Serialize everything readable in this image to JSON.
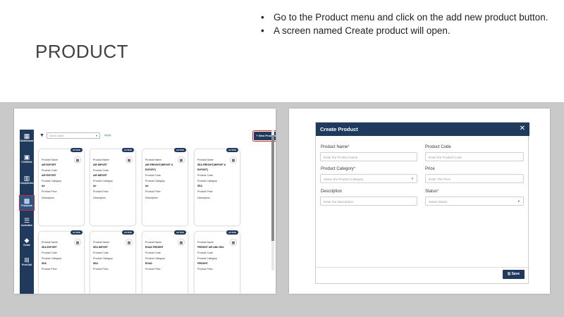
{
  "slide": {
    "title": "PRODUCT",
    "bullets": [
      "Go to the Product menu and click on the add new product button.",
      "A screen named Create product will open."
    ]
  },
  "left_screen": {
    "sidebar": [
      {
        "label": "Dashboard",
        "icon": "grid-icon",
        "glyph": "▦"
      },
      {
        "label": "Contacts",
        "icon": "contact-icon",
        "glyph": "▣"
      },
      {
        "label": "Companies",
        "icon": "building-icon",
        "glyph": "▥"
      },
      {
        "label": "Products",
        "icon": "box-icon",
        "glyph": "▩"
      },
      {
        "label": "Activities",
        "icon": "list-icon",
        "glyph": "☰"
      },
      {
        "label": "Deals",
        "icon": "tag-icon",
        "glyph": "◆"
      },
      {
        "label": "FreeCall",
        "icon": "network-icon",
        "glyph": "⊞"
      }
    ],
    "filter": {
      "placeholder": "Select Name",
      "caret": "▾",
      "apply": "Apply"
    },
    "new_product_button": "+ New Product",
    "more_button": "▾",
    "card_labels": {
      "badge": "ACTIVE",
      "name": "Product Name",
      "code": "Product Code",
      "category": "Product Category",
      "price": "Product Price",
      "description": "Description"
    },
    "cards_row1": [
      {
        "name": "AIR EXPORT",
        "name2": "",
        "code": "AIR EXPORT",
        "category": "Air"
      },
      {
        "name": "AIR IMPORT",
        "name2": "",
        "code": "AIR IMPORT",
        "category": "Air"
      },
      {
        "name": "AIR FREIGHT(IMPORT &",
        "name2": "EXPORT)",
        "code": "",
        "category": "Air"
      },
      {
        "name": "SEA FREIGHT(IMPORT &",
        "name2": "EXPORT)",
        "code": "",
        "category": "SEA"
      }
    ],
    "cards_row2": [
      {
        "name": "SEA EXPORT",
        "category": "SEA"
      },
      {
        "name": "SEA IMPORT",
        "category": "SEA"
      },
      {
        "name": "ROAD FREIGHT",
        "category": "ROAD"
      },
      {
        "name": "FREIGHT AIR AND SEA",
        "category": "FREIGHT"
      }
    ]
  },
  "modal": {
    "title": "Create Product",
    "close": "✕",
    "fields": {
      "product_name": {
        "label": "Product Name",
        "required": "*",
        "placeholder": "Enter the Product Name"
      },
      "product_code": {
        "label": "Product Code",
        "placeholder": "Enter the Product Code"
      },
      "product_category": {
        "label": "Product Category",
        "required": "*",
        "placeholder": "Select the Product Category",
        "caret": "▾"
      },
      "price": {
        "label": "Price",
        "placeholder": "Enter The Price"
      },
      "description": {
        "label": "Description",
        "placeholder": "Enter the Description"
      },
      "status": {
        "label": "Status",
        "required": "*",
        "placeholder": "Select Status",
        "caret": "▾"
      }
    },
    "save_button": "🖫 Save"
  },
  "colors": {
    "navy": "#1f3a5c",
    "highlight_red": "#d62b2b",
    "apply_green": "#2a8a2a"
  }
}
